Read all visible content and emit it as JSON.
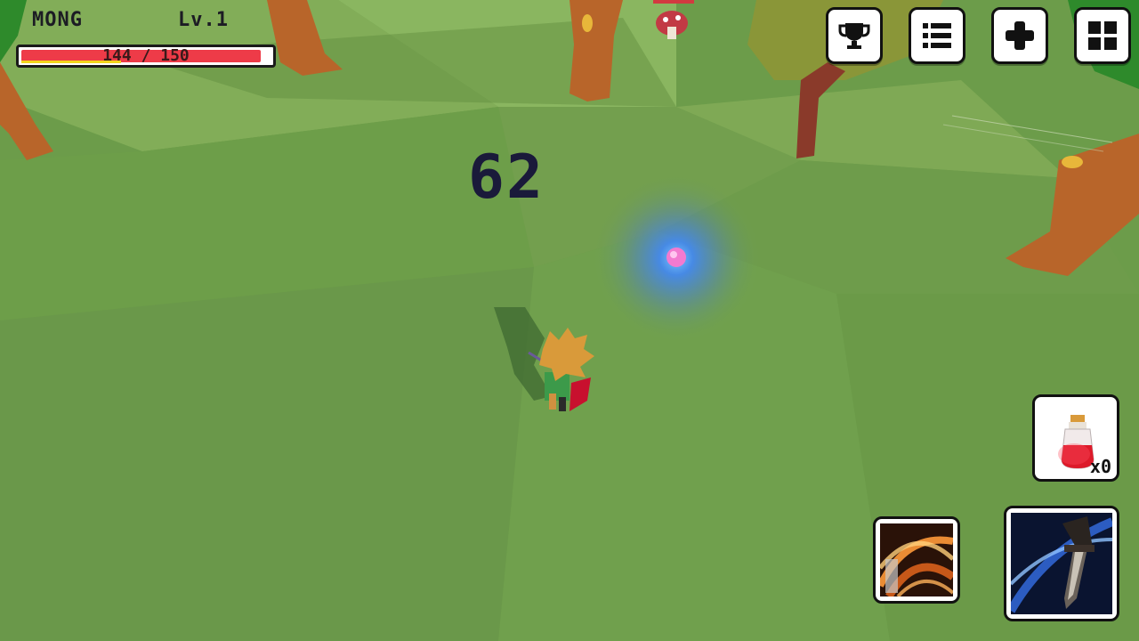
{
  "player": {
    "name": "MONG",
    "level_label": "Lv.1",
    "hp_text": "144 / 150",
    "hp_fraction": 0.96,
    "exp_fraction": 0.4
  },
  "combat": {
    "damage_number": "62"
  },
  "menu": {
    "buttons": [
      {
        "icon": "trophy-icon"
      },
      {
        "icon": "list-icon"
      },
      {
        "icon": "plus-icon"
      },
      {
        "icon": "grid-icon"
      }
    ]
  },
  "inventory": {
    "potion_count": "x0",
    "potion_icon": "health-potion-icon"
  },
  "skills": [
    {
      "icon": "fire-swirl-skill-icon"
    },
    {
      "icon": "sword-slash-skill-icon"
    }
  ],
  "colors": {
    "grass": "#6f9e4c",
    "hp_red": "#ee3b48",
    "exp_yellow": "#f2d51d",
    "tree_trunk": "#b8652a"
  }
}
